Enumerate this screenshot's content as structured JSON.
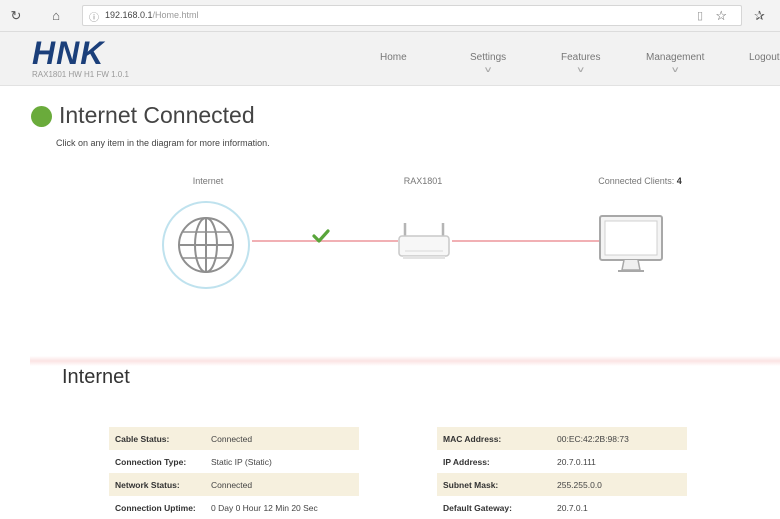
{
  "browser": {
    "url_host": "192.168.0.1",
    "url_path": "/Home.html"
  },
  "header": {
    "logo": "HNK",
    "firmware": "RAX1801 HW H1 FW 1.0.1",
    "nav": [
      {
        "label": "Home"
      },
      {
        "label": "Settings"
      },
      {
        "label": "Features"
      },
      {
        "label": "Management"
      },
      {
        "label": "Logout"
      }
    ]
  },
  "status": {
    "title": "Internet Connected",
    "subtitle": "Click on any item in the diagram for more information.",
    "color": "#6aab3b"
  },
  "diagram": {
    "internet_label": "Internet",
    "router_label": "RAX1801",
    "clients_label": "Connected Clients:",
    "clients_count": "4"
  },
  "section": {
    "title": "Internet"
  },
  "left_table": [
    {
      "label": "Cable Status:",
      "value": "Connected"
    },
    {
      "label": "Connection Type:",
      "value": "Static IP (Static)"
    },
    {
      "label": "Network Status:",
      "value": "Connected"
    },
    {
      "label": "Connection Uptime:",
      "value": "0 Day 0 Hour 12 Min 20 Sec"
    }
  ],
  "right_table": [
    {
      "label": "MAC Address:",
      "value": "00:EC:42:2B:98:73"
    },
    {
      "label": "IP Address:",
      "value": "20.7.0.111"
    },
    {
      "label": "Subnet Mask:",
      "value": "255.255.0.0"
    },
    {
      "label": "Default Gateway:",
      "value": "20.7.0.1"
    }
  ]
}
